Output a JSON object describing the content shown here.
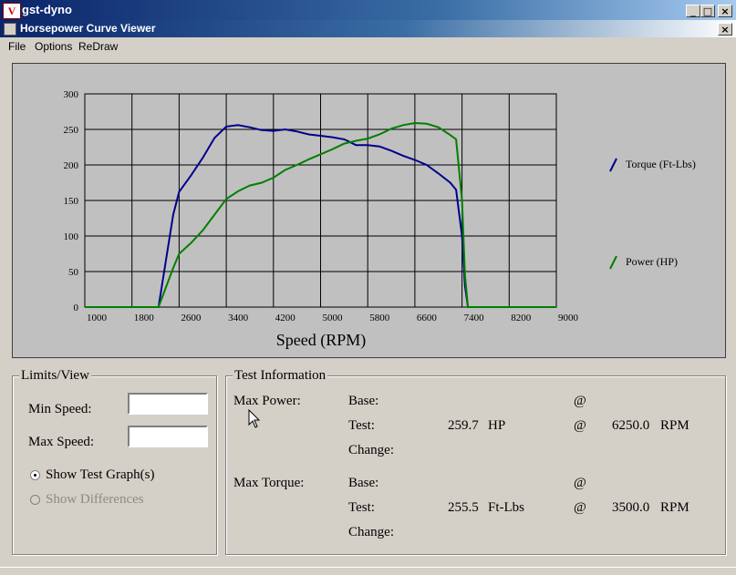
{
  "app_window": {
    "title": "gst-dyno",
    "icon_letter": "V"
  },
  "child_window": {
    "title": "Horsepower Curve Viewer"
  },
  "menu": [
    "File",
    "Options",
    "ReDraw"
  ],
  "chart_data": {
    "type": "line",
    "xlabel": "Speed (RPM)",
    "ylabel": "",
    "xlim": [
      1000,
      9000
    ],
    "ylim": [
      0,
      300
    ],
    "x_ticks": [
      1000,
      1800,
      2600,
      3400,
      4200,
      5000,
      5800,
      6600,
      7400,
      8200,
      9000
    ],
    "y_ticks": [
      0,
      50,
      100,
      150,
      200,
      250,
      300
    ],
    "grid": true,
    "legend_position": "right",
    "series": [
      {
        "name": "Torque (Ft-Lbs)",
        "color": "#00008b",
        "points": [
          [
            1000,
            0
          ],
          [
            2250,
            0
          ],
          [
            2500,
            130
          ],
          [
            2600,
            162
          ],
          [
            2800,
            185
          ],
          [
            3000,
            210
          ],
          [
            3200,
            238
          ],
          [
            3400,
            254
          ],
          [
            3600,
            256
          ],
          [
            3800,
            253
          ],
          [
            4000,
            249
          ],
          [
            4200,
            248
          ],
          [
            4400,
            250
          ],
          [
            4600,
            247
          ],
          [
            4800,
            243
          ],
          [
            5000,
            241
          ],
          [
            5200,
            239
          ],
          [
            5400,
            236
          ],
          [
            5600,
            228
          ],
          [
            5800,
            228
          ],
          [
            6000,
            226
          ],
          [
            6200,
            220
          ],
          [
            6400,
            213
          ],
          [
            6600,
            207
          ],
          [
            6800,
            200
          ],
          [
            7000,
            188
          ],
          [
            7200,
            175
          ],
          [
            7300,
            165
          ],
          [
            7400,
            100
          ],
          [
            7450,
            30
          ],
          [
            7500,
            0
          ],
          [
            9000,
            0
          ]
        ]
      },
      {
        "name": "Power (HP)",
        "color": "#008000",
        "points": [
          [
            1000,
            0
          ],
          [
            2250,
            0
          ],
          [
            2500,
            55
          ],
          [
            2600,
            75
          ],
          [
            2800,
            90
          ],
          [
            3000,
            108
          ],
          [
            3200,
            130
          ],
          [
            3400,
            152
          ],
          [
            3600,
            163
          ],
          [
            3800,
            171
          ],
          [
            4000,
            175
          ],
          [
            4200,
            182
          ],
          [
            4400,
            193
          ],
          [
            4600,
            200
          ],
          [
            4800,
            208
          ],
          [
            5000,
            215
          ],
          [
            5200,
            222
          ],
          [
            5400,
            230
          ],
          [
            5600,
            234
          ],
          [
            5800,
            237
          ],
          [
            6000,
            243
          ],
          [
            6200,
            251
          ],
          [
            6400,
            256
          ],
          [
            6600,
            259
          ],
          [
            6800,
            258
          ],
          [
            7000,
            253
          ],
          [
            7200,
            242
          ],
          [
            7300,
            236
          ],
          [
            7400,
            150
          ],
          [
            7450,
            45
          ],
          [
            7500,
            0
          ],
          [
            9000,
            0
          ]
        ]
      }
    ]
  },
  "limits_view": {
    "title": "Limits/View",
    "min_speed_label": "Min Speed:",
    "min_speed_value": "",
    "max_speed_label": "Max Speed:",
    "max_speed_value": "",
    "show_test_label": "Show Test Graph(s)",
    "show_diff_label": "Show Differences"
  },
  "test_info": {
    "title": "Test Information",
    "max_power_label": "Max Power:",
    "max_torque_label": "Max Torque:",
    "base_label": "Base:",
    "test_label": "Test:",
    "change_label": "Change:",
    "at": "@",
    "power_test_value": "259.7",
    "power_unit": "HP",
    "power_rpm": "6250.0",
    "torque_test_value": "255.5",
    "torque_unit": "Ft-Lbs",
    "torque_rpm": "3500.0",
    "rpm_unit": "RPM"
  }
}
